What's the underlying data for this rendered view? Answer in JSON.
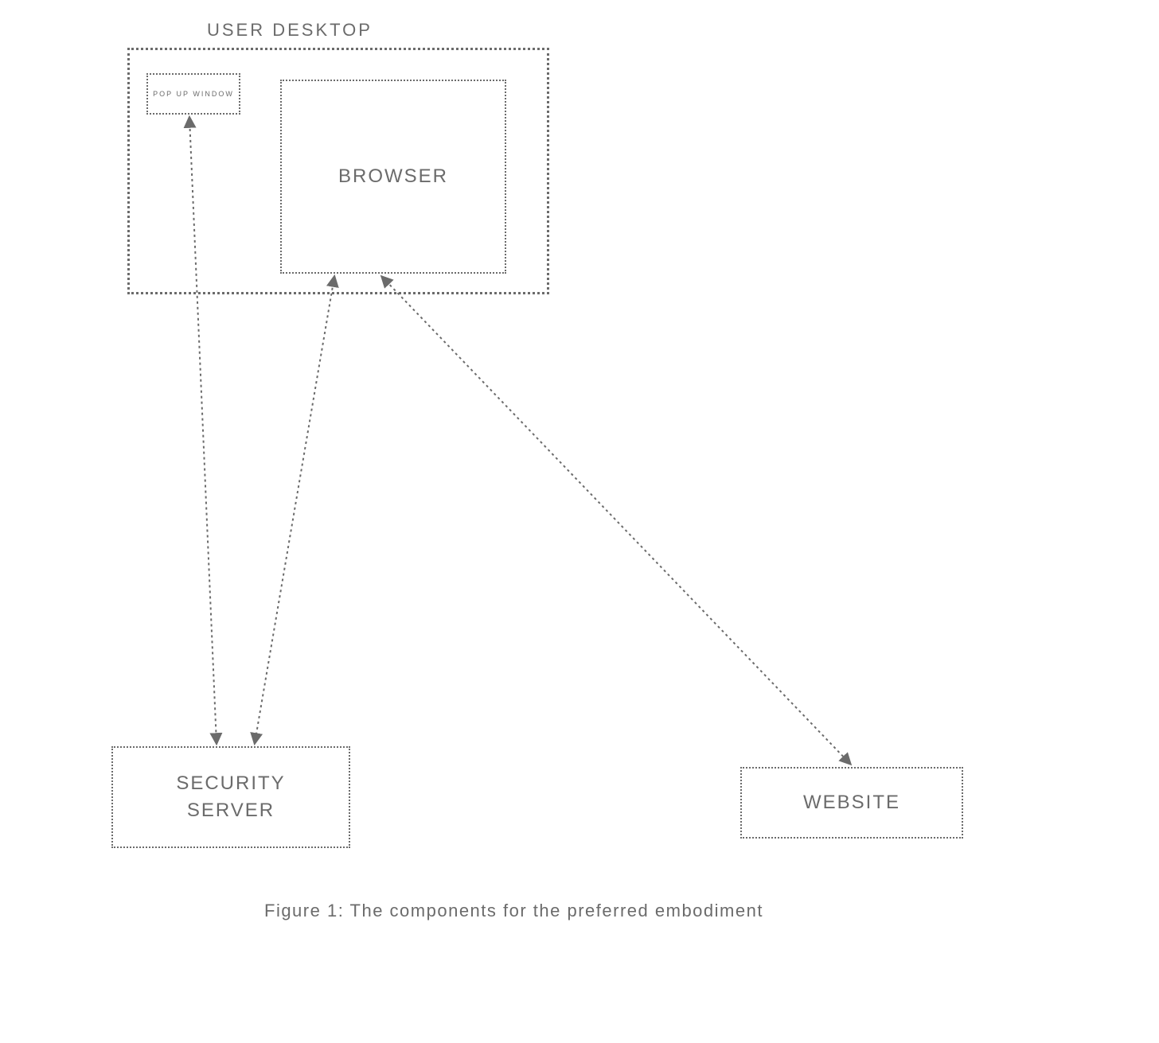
{
  "diagram": {
    "title": "USER DESKTOP",
    "popup": "POP UP WINDOW",
    "browser": "BROWSER",
    "security": "SECURITY SERVER",
    "website": "WEBSITE",
    "caption": "Figure 1: The components for the preferred embodiment"
  }
}
